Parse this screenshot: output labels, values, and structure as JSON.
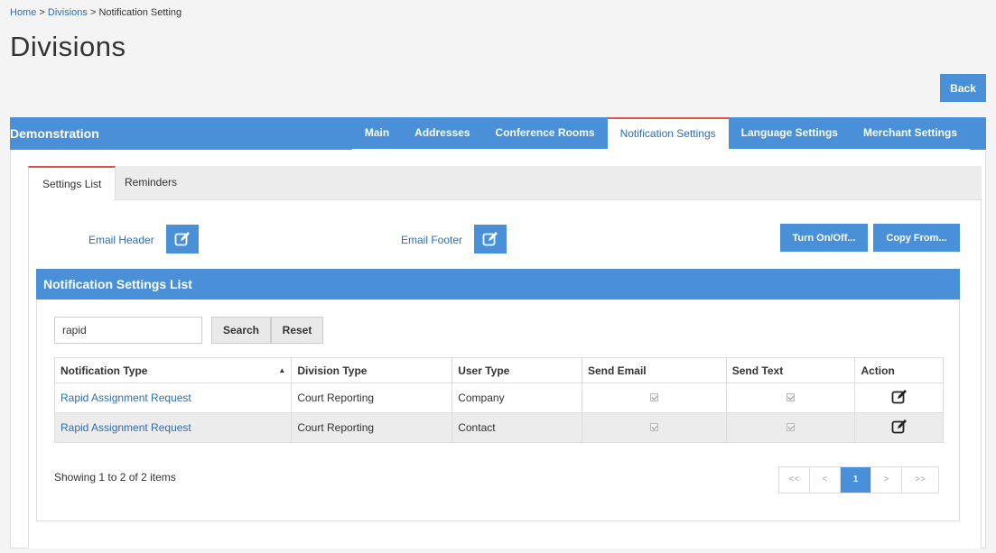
{
  "breadcrumb": {
    "home": "Home",
    "sep1": " > ",
    "divisions": "Divisions",
    "sep2": " > ",
    "current": "Notification Setting"
  },
  "page_title": "Divisions",
  "back_label": "Back",
  "division_name": "Demonstration",
  "nav_tabs": [
    "Main",
    "Addresses",
    "Conference Rooms",
    "Notification Settings",
    "Language Settings",
    "Merchant Settings"
  ],
  "inner_tabs": [
    "Settings List",
    "Reminders"
  ],
  "email_header_label": "Email Header",
  "email_footer_label": "Email Footer",
  "turn_on_off_label": "Turn On/Off...",
  "copy_from_label": "Copy From...",
  "list_title": "Notification Settings List",
  "search": {
    "value": "rapid"
  },
  "search_label": "Search",
  "reset_label": "Reset",
  "table": {
    "headers": [
      "Notification Type",
      "Division Type",
      "User Type",
      "Send Email",
      "Send Text",
      "Action"
    ],
    "sort_indicator": "▲",
    "rows": [
      {
        "notification_type": "Rapid Assignment Request",
        "division_type": "Court Reporting",
        "user_type": "Company",
        "send_email": true,
        "send_text": true
      },
      {
        "notification_type": "Rapid Assignment Request",
        "division_type": "Court Reporting",
        "user_type": "Contact",
        "send_email": true,
        "send_text": true
      }
    ]
  },
  "pager_info": "Showing 1 to 2 of 2 items",
  "pager": {
    "first": "<<",
    "prev": "<",
    "current": "1",
    "next": ">",
    "last": ">>"
  },
  "colors": {
    "accent": "#4a90d9",
    "active_tab_border": "#d9534f",
    "link": "#2e6db4"
  },
  "icons": {
    "edit": "edit-icon"
  }
}
